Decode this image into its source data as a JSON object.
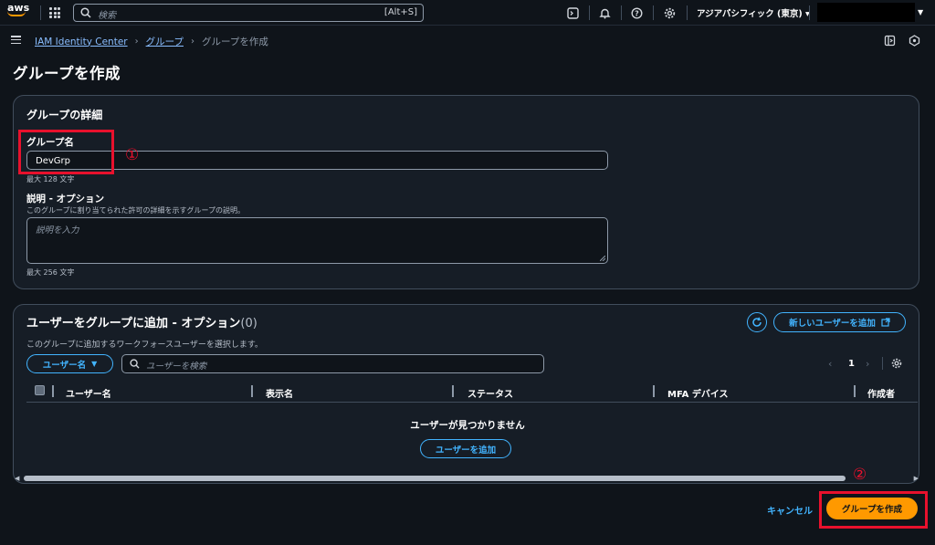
{
  "topnav": {
    "logo_text": "aws",
    "search_placeholder": "検索",
    "search_shortcut": "[Alt+S]",
    "region": "アジアパシフィック (東京) ▾"
  },
  "breadcrumb": {
    "items": [
      "IAM Identity Center",
      "グループ"
    ],
    "current": "グループを作成"
  },
  "page": {
    "title": "グループを作成"
  },
  "details": {
    "title": "グループの詳細",
    "group_name_label": "グループ名",
    "group_name_value": "DevGrp",
    "group_name_hint": "最大 128 文字",
    "desc_label": "説明 - オプション",
    "desc_sublabel": "このグループに割り当てられた許可の詳細を示すグループの説明。",
    "desc_placeholder": "説明を入力",
    "desc_hint": "最大 256 文字",
    "annotation_1": "①"
  },
  "users": {
    "title": "ユーザーをグループに追加 - オプション",
    "count": "(0)",
    "subtitle": "このグループに追加するワークフォースユーザーを選択します。",
    "new_user_button": "新しいユーザーを追加",
    "filter_dropdown": "ユーザー名",
    "filter_placeholder": "ユーザーを検索",
    "page_number": "1",
    "columns": [
      "ユーザー名",
      "表示名",
      "ステータス",
      "MFA デバイス",
      "作成者"
    ],
    "empty_message": "ユーザーが見つかりません",
    "add_user_button": "ユーザーを追加"
  },
  "footer": {
    "cancel": "キャンセル",
    "create": "グループを作成",
    "annotation_2": "②"
  },
  "colors": {
    "accent": "#42b4ff",
    "primary": "#ff9900",
    "highlight": "#e8112d"
  }
}
